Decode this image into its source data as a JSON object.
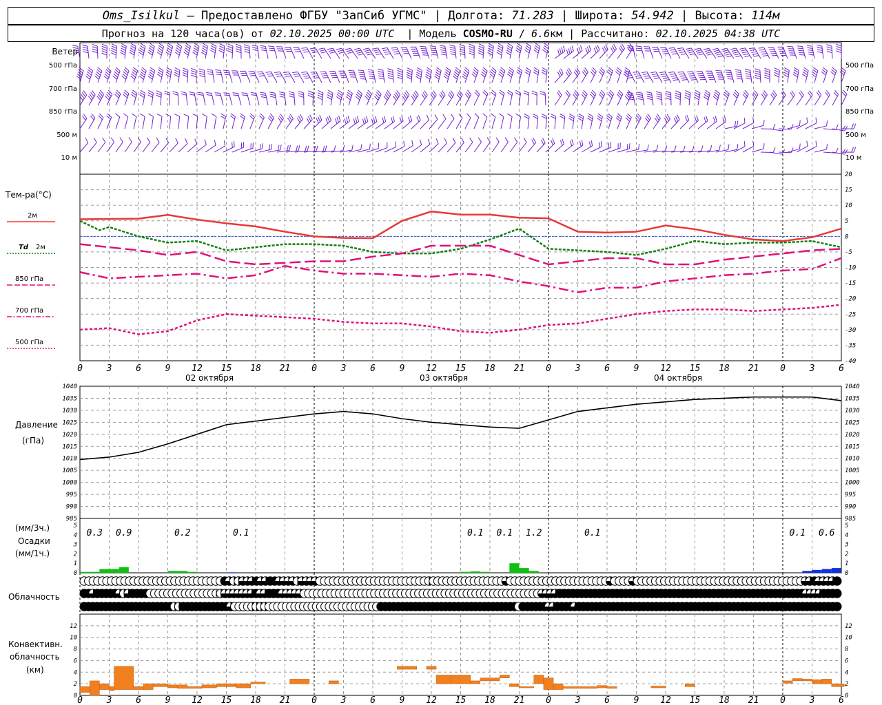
{
  "header": {
    "station": "Oms_Isilkul",
    "line1_mid": " – Предоставлено ФГБУ \"ЗапСиб УГМС\" | Долгота: ",
    "lon": "71.283",
    "lat_label": " | Широта: ",
    "lat": "54.942",
    "alt_label": " | Высота: ",
    "alt": "114м",
    "line2_a": "Прогноз на 120 часа(ов) от ",
    "run": "02.10.2025 00:00 UTC",
    "line2_b": "  | Модель ",
    "model": "COSMO-RU",
    "line2_c": " / ",
    "res": "6.6",
    "line2_d": "км | Рассчитано: ",
    "calc": "02.10.2025 04:38 UTC"
  },
  "labels": {
    "wind": "Ветер",
    "lvl500": "500 гПа",
    "lvl700": "700 гПа",
    "lvl850": "850 гПа",
    "lvl500m": "500  м",
    "lvl10m": "10   м",
    "temp": "Тем-ра(°C)",
    "t2m": "2м",
    "td": "Td",
    "td2": "2м",
    "t850": "850 гПа",
    "t700": "700 гПа",
    "t500": "500 гПа",
    "pres": "Давление",
    "pres_unit": "(гПа)",
    "precip1": "(мм/3ч.)",
    "precip2": "Осадки",
    "precip3": "(мм/1ч.)",
    "cloud": "Облачность",
    "conv1": "Конвективн.",
    "conv2": "облачность",
    "conv3": "(км)",
    "day1": "02 октября",
    "day2": "03 октября",
    "day3": "04 октября"
  },
  "colors": {
    "wind": "#7020d0",
    "t2m": "#e83838",
    "td": "#108010",
    "upper": "#e0107a",
    "precip3h": "#10c010",
    "precip1h": "#1030e0",
    "conv": "#f08020",
    "grid": "#999999"
  },
  "chart_data": [
    {
      "type": "line",
      "title": "Тем-ра(°C)",
      "x_hours": [
        0,
        6,
        12,
        18,
        24,
        30,
        36,
        42,
        48,
        54,
        60,
        66,
        72,
        78,
        84,
        90,
        96,
        102,
        108,
        114,
        120,
        126,
        132,
        138,
        144,
        150
      ],
      "x_ticks": [
        "0",
        "3",
        "6",
        "9",
        "12",
        "15",
        "18",
        "21",
        "0",
        "3",
        "6",
        "9",
        "12",
        "15",
        "18",
        "21",
        "0",
        "3",
        "6",
        "9",
        "12",
        "15",
        "18",
        "21",
        "0",
        "3",
        "6"
      ],
      "ylim": [
        -40,
        20
      ],
      "series": [
        {
          "name": "2м",
          "x": [
            0,
            3,
            6,
            9,
            12,
            15,
            18,
            21,
            24,
            27,
            30,
            33,
            36,
            39,
            42,
            45,
            48,
            51,
            54,
            57,
            60,
            63,
            66,
            69,
            72,
            75,
            78
          ],
          "values": [
            5.5,
            5.6,
            5.7,
            6.9,
            5.4,
            4.2,
            3.2,
            1.5,
            0,
            -0.5,
            -0.6,
            5,
            8,
            7,
            7,
            6,
            5.8,
            1.5,
            1.2,
            1.5,
            3.5,
            2.3,
            0.5,
            -1,
            -1.5,
            -0.3,
            2.5
          ]
        },
        {
          "name": "Td 2м",
          "x": [
            0,
            2,
            3,
            6,
            9,
            12,
            15,
            18,
            21,
            24,
            27,
            30,
            33,
            36,
            39,
            42,
            45,
            48,
            51,
            54,
            57,
            60,
            63,
            66,
            69,
            72,
            75,
            78
          ],
          "values": [
            5,
            2,
            3,
            0,
            -2,
            -1.5,
            -4.5,
            -3.5,
            -2.5,
            -2.5,
            -3,
            -5,
            -5.5,
            -5.5,
            -4,
            -1,
            2.5,
            -4,
            -4.5,
            -5,
            -6,
            -4,
            -1.5,
            -2.5,
            -2,
            -2,
            -1.5,
            -3.5
          ]
        },
        {
          "name": "850 гПа",
          "x": [
            0,
            3,
            6,
            9,
            12,
            15,
            18,
            21,
            24,
            27,
            30,
            33,
            36,
            39,
            42,
            45,
            48,
            51,
            54,
            57,
            60,
            63,
            66,
            69,
            72,
            75,
            78
          ],
          "values": [
            -2.5,
            -3.5,
            -4.5,
            -6,
            -5,
            -8,
            -9,
            -8.5,
            -8,
            -8,
            -6.5,
            -5.5,
            -3,
            -3,
            -3,
            -6,
            -9,
            -8,
            -7,
            -7,
            -9,
            -9,
            -7.5,
            -6.5,
            -5.5,
            -4.5,
            -4
          ]
        },
        {
          "name": "700 гПа",
          "x": [
            0,
            3,
            6,
            9,
            12,
            15,
            18,
            21,
            24,
            27,
            30,
            33,
            36,
            39,
            42,
            45,
            48,
            51,
            54,
            57,
            60,
            63,
            66,
            69,
            72,
            75,
            78
          ],
          "values": [
            -11.5,
            -13.5,
            -13,
            -12.5,
            -12,
            -13.5,
            -12.5,
            -9.5,
            -11,
            -12,
            -12,
            -12.5,
            -13,
            -12,
            -12.5,
            -14.5,
            -16,
            -18,
            -16.5,
            -16.5,
            -14.5,
            -13.5,
            -12.5,
            -12,
            -11,
            -10.5,
            -7
          ]
        },
        {
          "name": "500 гПа",
          "x": [
            0,
            3,
            6,
            9,
            12,
            15,
            18,
            21,
            24,
            27,
            30,
            33,
            36,
            39,
            42,
            45,
            48,
            51,
            54,
            57,
            60,
            63,
            66,
            69,
            72,
            75,
            78
          ],
          "values": [
            -30,
            -29.5,
            -31.5,
            -30.5,
            -27,
            -25,
            -25.5,
            -26,
            -26.5,
            -27.5,
            -28,
            -28,
            -29,
            -30.5,
            -31,
            -30,
            -28.5,
            -28,
            -26.5,
            -25,
            -24,
            -23.5,
            -23.5,
            -24,
            -23.5,
            -23,
            -22
          ]
        }
      ]
    },
    {
      "type": "line",
      "title": "Давление",
      "ylabel": "(гПа)",
      "ylim": [
        985,
        1040
      ],
      "series": [
        {
          "name": "Давление",
          "x": [
            0,
            3,
            6,
            9,
            12,
            15,
            18,
            21,
            24,
            27,
            30,
            33,
            36,
            39,
            42,
            45,
            48,
            51,
            54,
            57,
            60,
            63,
            66,
            69,
            72,
            75,
            78
          ],
          "values": [
            1009.5,
            1010.5,
            1012.5,
            1016,
            1020,
            1024,
            1025.5,
            1027,
            1028.5,
            1029.5,
            1028.5,
            1026.5,
            1025,
            1024,
            1023,
            1022.5,
            1026,
            1029.5,
            1031,
            1032.5,
            1033.5,
            1034.5,
            1035,
            1035.5,
            1035.5,
            1035.5,
            1034
          ]
        }
      ]
    },
    {
      "type": "bar",
      "title": "Осадки",
      "labels_3h": [
        {
          "x": 1.5,
          "text": "0.3"
        },
        {
          "x": 4.5,
          "text": "0.9"
        },
        {
          "x": 10.5,
          "text": "0.2"
        },
        {
          "x": 16.5,
          "text": "0.1"
        },
        {
          "x": 40.5,
          "text": "0.1"
        },
        {
          "x": 43.5,
          "text": "0.1"
        },
        {
          "x": 46.5,
          "text": "1.2"
        },
        {
          "x": 52.5,
          "text": "0.1"
        },
        {
          "x": 73.5,
          "text": "0.1"
        },
        {
          "x": 76.5,
          "text": "0.6"
        }
      ],
      "ylim": [
        0,
        5
      ],
      "series": [
        {
          "name": "3ч",
          "x": [
            1,
            2,
            3,
            4,
            5,
            10,
            11,
            12,
            40,
            41,
            42,
            45,
            46,
            47
          ],
          "values": [
            0.1,
            0.1,
            0.4,
            0.4,
            0.6,
            0.2,
            0.2,
            0.1,
            0.1,
            0.15,
            0.1,
            1,
            0.5,
            0.2
          ]
        },
        {
          "name": "1ч",
          "x": [
            16,
            75,
            76,
            77,
            78
          ],
          "values": [
            0.05,
            0.2,
            0.3,
            0.4,
            0.5
          ]
        }
      ]
    },
    {
      "type": "bar",
      "title": "Конвективн. облачность",
      "ylabel": "(км)",
      "ylim": [
        0,
        13
      ],
      "series": [
        {
          "name": "conv",
          "bars": [
            [
              0,
              1,
              0.5,
              1.5
            ],
            [
              1,
              2,
              0,
              2.5
            ],
            [
              2,
              3,
              1,
              2
            ],
            [
              3,
              3.5,
              0.8,
              1.5
            ],
            [
              3.5,
              5.5,
              1,
              5
            ],
            [
              5.5,
              6.5,
              1,
              1.5
            ],
            [
              6.5,
              7.5,
              1,
              2
            ],
            [
              7.5,
              9,
              1.5,
              2
            ],
            [
              9,
              10,
              1.3,
              1.8
            ],
            [
              10,
              11,
              1.2,
              1.8
            ],
            [
              11,
              12.5,
              1.2,
              1.5
            ],
            [
              12.5,
              14,
              1.3,
              1.8
            ],
            [
              14,
              15,
              1.5,
              2
            ],
            [
              15,
              16,
              1.5,
              2
            ],
            [
              16,
              17.5,
              1.3,
              2
            ],
            [
              17.5,
              19,
              2,
              2.3
            ],
            [
              21.5,
              23.5,
              2,
              2.8
            ],
            [
              25.5,
              26.5,
              2,
              2.5
            ],
            [
              32.5,
              34.5,
              4.5,
              5
            ],
            [
              35.5,
              36.5,
              4.5,
              5
            ],
            [
              36.5,
              38,
              2,
              3.5
            ],
            [
              38,
              40,
              2,
              3.5
            ],
            [
              40,
              41,
              2,
              2.5
            ],
            [
              41,
              43,
              2.5,
              3
            ],
            [
              43,
              44,
              3,
              3.5
            ],
            [
              44,
              45,
              1.5,
              2
            ],
            [
              45,
              46.5,
              1.3,
              1.5
            ],
            [
              46.5,
              47.5,
              2,
              3.5
            ],
            [
              47.5,
              48.5,
              1,
              3
            ],
            [
              48.5,
              49.5,
              1,
              2
            ],
            [
              49.5,
              50.5,
              1.2,
              1.5
            ],
            [
              50.5,
              53,
              1.2,
              1.5
            ],
            [
              53,
              54,
              1.3,
              1.7
            ],
            [
              54,
              55,
              1.2,
              1.5
            ],
            [
              58.5,
              60,
              1.3,
              1.6
            ],
            [
              62,
              63,
              1.5,
              2
            ],
            [
              72,
              73,
              2.1,
              2.5
            ],
            [
              73,
              74,
              2.5,
              2.9
            ],
            [
              74,
              75,
              2.5,
              2.8
            ],
            [
              75,
              76,
              2,
              2.7
            ],
            [
              76,
              77,
              2,
              2.8
            ],
            [
              77,
              78.3,
              1.5,
              2
            ]
          ]
        }
      ]
    }
  ],
  "clouds": {
    "row1": [
      0,
      0,
      0,
      0,
      0,
      0,
      0,
      0,
      0,
      0,
      0,
      0,
      0,
      0,
      0,
      0,
      0,
      0,
      0,
      0,
      0,
      0,
      0,
      0,
      0,
      0,
      0,
      0,
      0,
      0,
      0,
      4,
      3,
      2,
      2,
      3,
      3,
      3,
      4,
      3,
      3,
      4,
      4,
      3,
      3,
      3,
      3,
      2,
      3,
      3,
      3,
      3,
      0,
      0,
      0,
      0,
      0,
      0,
      0,
      0,
      0,
      0,
      0,
      0,
      0,
      0,
      0,
      0,
      0,
      0,
      0,
      0,
      0,
      0,
      0,
      0,
      2,
      0,
      0,
      0,
      0,
      0,
      0,
      0,
      0,
      0,
      0,
      0,
      0,
      0,
      0,
      0,
      0,
      3,
      0,
      0,
      0,
      0,
      0,
      0,
      0,
      0,
      0,
      0,
      0,
      0,
      0,
      0,
      0,
      0,
      0,
      0,
      0,
      0,
      0,
      0,
      3,
      0,
      0,
      0,
      0,
      3,
      0,
      0,
      0,
      0,
      0,
      0,
      0,
      0,
      0,
      0,
      0,
      0,
      0,
      0,
      0,
      0,
      0,
      0,
      0,
      0,
      0,
      0,
      0,
      0,
      0,
      0,
      0,
      0,
      0,
      0,
      0,
      0,
      0,
      0,
      0,
      0,
      0,
      3,
      3,
      4,
      3,
      3,
      3,
      3,
      4
    ],
    "row2": [
      4,
      4,
      3,
      4,
      4,
      4,
      4,
      4,
      3,
      2,
      3,
      4,
      4,
      4,
      4,
      0,
      0,
      0,
      0,
      0,
      0,
      0,
      0,
      0,
      0,
      0,
      0,
      0,
      0,
      0,
      1,
      2,
      3,
      3,
      3,
      3,
      3,
      3,
      3,
      4,
      3,
      3,
      4,
      4,
      4,
      3,
      3,
      3,
      3,
      3,
      0,
      0,
      0,
      0,
      0,
      0,
      0,
      0,
      0,
      0,
      0,
      0,
      0,
      0,
      0,
      0,
      0,
      0,
      0,
      0,
      0,
      0,
      0,
      0,
      0,
      0,
      0,
      0,
      0,
      0,
      0,
      0,
      0,
      0,
      0,
      0,
      0,
      0,
      0,
      0,
      0,
      0,
      0,
      0,
      0,
      0,
      0,
      0,
      0,
      0,
      0,
      0,
      0,
      0,
      3,
      3,
      3,
      3,
      4,
      4,
      4,
      4,
      4,
      4,
      4,
      4,
      4,
      4,
      4,
      4,
      4,
      4,
      4,
      4,
      4,
      4,
      4,
      4,
      4,
      4,
      4,
      4,
      4,
      4,
      4,
      4,
      4,
      4,
      4,
      4,
      4,
      4,
      4,
      4,
      4,
      4,
      4,
      4,
      4,
      4,
      4,
      4,
      4,
      4,
      4,
      4,
      4,
      4,
      4,
      4,
      4,
      4,
      4,
      4,
      3,
      3,
      3,
      3,
      4,
      4,
      4,
      4
    ],
    "row3": [
      4,
      4,
      4,
      4,
      4,
      4,
      4,
      4,
      4,
      4,
      4,
      4,
      4,
      4,
      4,
      4,
      4,
      4,
      4,
      4,
      4,
      2,
      2,
      4,
      4,
      4,
      4,
      4,
      4,
      4,
      4,
      4,
      4,
      4,
      3,
      0,
      0,
      0,
      0,
      2,
      2,
      2,
      2,
      0,
      0,
      0,
      0,
      0,
      0,
      0,
      0,
      0,
      0,
      0,
      0,
      0,
      0,
      0,
      0,
      0,
      0,
      0,
      0,
      0,
      0,
      0,
      0,
      0,
      0,
      4,
      4,
      4,
      4,
      4,
      4,
      4,
      4,
      4,
      4,
      4,
      4,
      4,
      4,
      4,
      4,
      4,
      4,
      4,
      4,
      4,
      4,
      4,
      4,
      4,
      4,
      4,
      4,
      4,
      4,
      4,
      4,
      0,
      4,
      4,
      4,
      4,
      4,
      4,
      3,
      3,
      4,
      4,
      4,
      4,
      3,
      4,
      4,
      4,
      4,
      4,
      4,
      4,
      4,
      4,
      4,
      4,
      4,
      4,
      4,
      4,
      4,
      4,
      4,
      4,
      4,
      4,
      4,
      4,
      4,
      4,
      4,
      4,
      4,
      4,
      4,
      4,
      4,
      4,
      4,
      4,
      4,
      4,
      4,
      4,
      4,
      4,
      4,
      4,
      4,
      4,
      4,
      4,
      4,
      4,
      4,
      4,
      4,
      4,
      4,
      4,
      4,
      4,
      4,
      4,
      4,
      4
    ]
  }
}
